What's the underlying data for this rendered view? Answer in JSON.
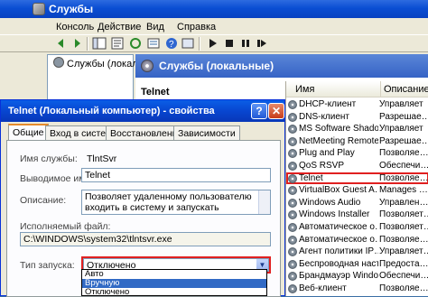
{
  "window": {
    "title": "Службы"
  },
  "menu": [
    "Консоль",
    "Действие",
    "Вид",
    "Справка"
  ],
  "tree": {
    "root": "Службы (локальные)"
  },
  "right_pane": {
    "header": "Службы (локальные)",
    "selected_service": "Telnet"
  },
  "services_list": {
    "columns": [
      "Имя",
      "Описание"
    ],
    "rows": [
      {
        "name": "DHCP-клиент",
        "desc": "Управляет"
      },
      {
        "name": "DNS-клиент",
        "desc": "Разрешае…"
      },
      {
        "name": "MS Software Shado…",
        "desc": "Управляет"
      },
      {
        "name": "NetMeeting Remote…",
        "desc": "Разрешае…"
      },
      {
        "name": "Plug and Play",
        "desc": "Позволяе…"
      },
      {
        "name": "QoS RSVP",
        "desc": "Обеспечи…"
      },
      {
        "name": "Telnet",
        "desc": "Позволяе…",
        "selected": true
      },
      {
        "name": "VirtualBox Guest A…",
        "desc": "Manages …"
      },
      {
        "name": "Windows Audio",
        "desc": "Управлен…"
      },
      {
        "name": "Windows Installer",
        "desc": "Позволяет…"
      },
      {
        "name": "Автоматическое о…",
        "desc": "Позволяет…"
      },
      {
        "name": "Автоматическое о…",
        "desc": "Позволяе…"
      },
      {
        "name": "Агент политики IP…",
        "desc": "Управляет…"
      },
      {
        "name": "Беспроводная наст…",
        "desc": "Предоста…"
      },
      {
        "name": "Брандмауэр Windo…",
        "desc": "Обеспечи…"
      },
      {
        "name": "Веб-клиент",
        "desc": "Позволяе…"
      }
    ]
  },
  "dialog": {
    "title": "Telnet (Локальный компьютер) - свойства",
    "help_label": "?",
    "close_label": "✕",
    "tabs": [
      "Общие",
      "Вход в систему",
      "Восстановление",
      "Зависимости"
    ],
    "service_name_label": "Имя службы:",
    "service_name_value": "TlntSvr",
    "display_name_label": "Выводимое имя:",
    "display_name_value": "Telnet",
    "description_label": "Описание:",
    "description_value": "Позволяет удаленному пользователю входить в систему и запускать программы, поддерживает",
    "exe_label": "Исполняемый файл:",
    "exe_value": "C:\\WINDOWS\\system32\\tlntsvr.exe",
    "startup_label": "Тип запуска:",
    "startup_value": "Отключено",
    "startup_options": [
      "Авто",
      "Вручную",
      "Отключено"
    ],
    "highlighted_option": 1
  },
  "colors": {
    "selection": "#316ac5",
    "highlight_box": "#e02020",
    "title_blue": "#0a4ed3"
  }
}
